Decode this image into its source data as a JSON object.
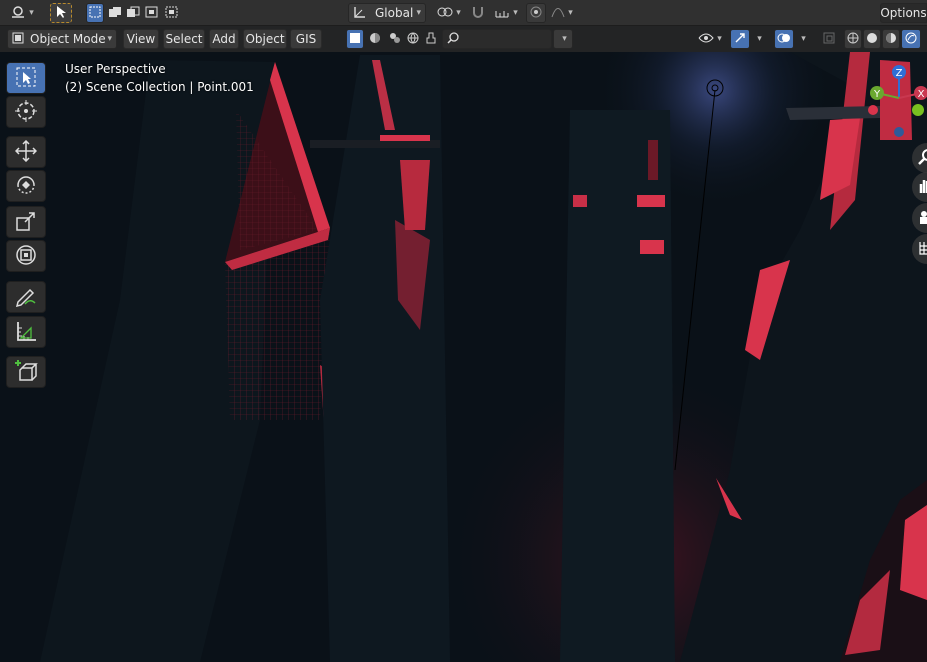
{
  "topbar": {
    "transform_orientation": "Global",
    "options_label": "Options"
  },
  "header": {
    "mode_label": "Object Mode",
    "menu": [
      "View",
      "Select",
      "Add",
      "Object",
      "GIS"
    ],
    "search_placeholder": ""
  },
  "viewport": {
    "perspective_label": "User Perspective",
    "collection_label": "(2) Scene Collection | Point.001"
  },
  "gizmo": {
    "z_label": "Z",
    "y_label": "Y",
    "x_label": "X"
  },
  "colors": {
    "accent_blue": "#4772b3",
    "scene_red": "#d8344c",
    "background": "#0a1118"
  },
  "toolbar_tools": [
    "select-box-icon",
    "cursor-icon",
    "move-icon",
    "rotate-icon",
    "scale-icon",
    "transform-icon",
    "annotate-icon",
    "measure-icon",
    "add-cube-icon"
  ]
}
